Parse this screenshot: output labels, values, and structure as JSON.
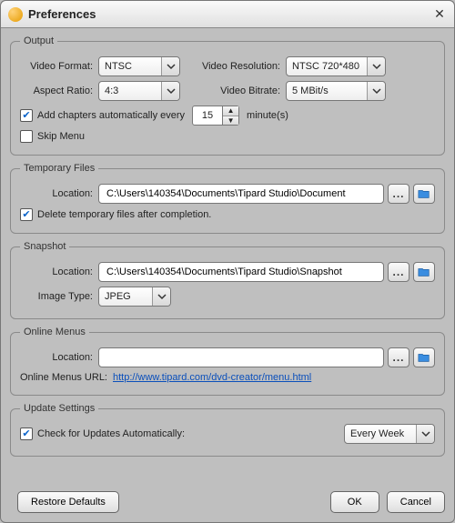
{
  "titlebar": {
    "title": "Preferences"
  },
  "output": {
    "legend": "Output",
    "video_format_label": "Video Format:",
    "video_format_value": "NTSC",
    "video_resolution_label": "Video Resolution:",
    "video_resolution_value": "NTSC 720*480",
    "aspect_ratio_label": "Aspect Ratio:",
    "aspect_ratio_value": "4:3",
    "video_bitrate_label": "Video Bitrate:",
    "video_bitrate_value": "5 MBit/s",
    "add_chapters_label": "Add chapters automatically every",
    "add_chapters_value": "15",
    "add_chapters_unit": "minute(s)",
    "skip_menu_label": "Skip Menu"
  },
  "temp": {
    "legend": "Temporary Files",
    "location_label": "Location:",
    "location_value": "C:\\Users\\140354\\Documents\\Tipard Studio\\Document",
    "delete_label": "Delete temporary files after completion."
  },
  "snapshot": {
    "legend": "Snapshot",
    "location_label": "Location:",
    "location_value": "C:\\Users\\140354\\Documents\\Tipard Studio\\Snapshot",
    "image_type_label": "Image Type:",
    "image_type_value": "JPEG"
  },
  "online": {
    "legend": "Online Menus",
    "location_label": "Location:",
    "location_value": "",
    "url_label": "Online Menus URL:",
    "url_value": "http://www.tipard.com/dvd-creator/menu.html"
  },
  "update": {
    "legend": "Update Settings",
    "check_label": "Check for Updates Automatically:",
    "frequency_value": "Every Week"
  },
  "footer": {
    "restore": "Restore Defaults",
    "ok": "OK",
    "cancel": "Cancel"
  }
}
